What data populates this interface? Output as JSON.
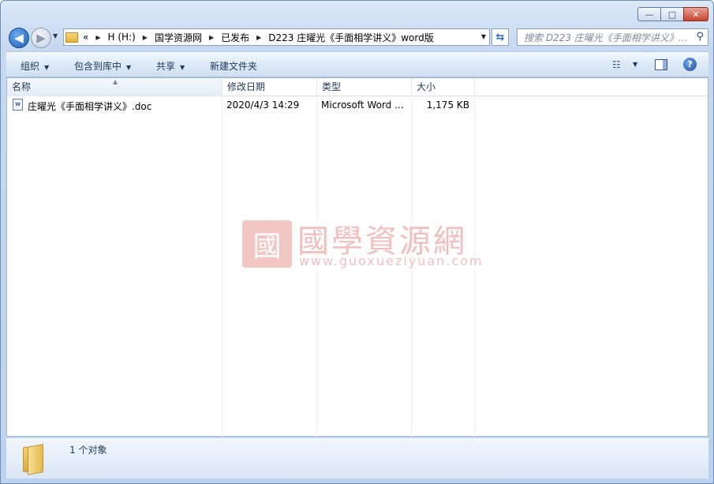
{
  "window": {
    "caption_min": "—",
    "caption_max": "□",
    "caption_close": "✕"
  },
  "nav": {
    "back_glyph": "◀",
    "forward_glyph": "▶",
    "overflow": "«",
    "breadcrumbs": [
      "H (H:)",
      "国学资源网",
      "已发布",
      "D223 庄曜光《手面相学讲义》word版"
    ],
    "search_placeholder": "搜索 D223 庄曜光《手面相学讲义》...",
    "refresh_glyph": "⇆"
  },
  "toolbar": {
    "organize": "组织",
    "include_in_library": "包含到库中",
    "share": "共享",
    "new_folder": "新建文件夹",
    "view_glyph": "☷",
    "help_glyph": "?"
  },
  "columns": {
    "name": "名称",
    "modified": "修改日期",
    "type": "类型",
    "size": "大小"
  },
  "files": [
    {
      "name": "庄曜光《手面相学讲义》.doc",
      "modified": "2020/4/3 14:29",
      "type": "Microsoft Word ...",
      "size": "1,175 KB",
      "icon": "word-doc-icon"
    }
  ],
  "watermark": {
    "logo_char": "國",
    "title": "國學資源網",
    "url": "www.guoxueziyuan.com"
  },
  "details": {
    "item_count": "1 个对象"
  },
  "colors": {
    "accent": "#1b5fb8",
    "watermark": "#f2bfbd",
    "chrome": "#c6d9f0"
  }
}
